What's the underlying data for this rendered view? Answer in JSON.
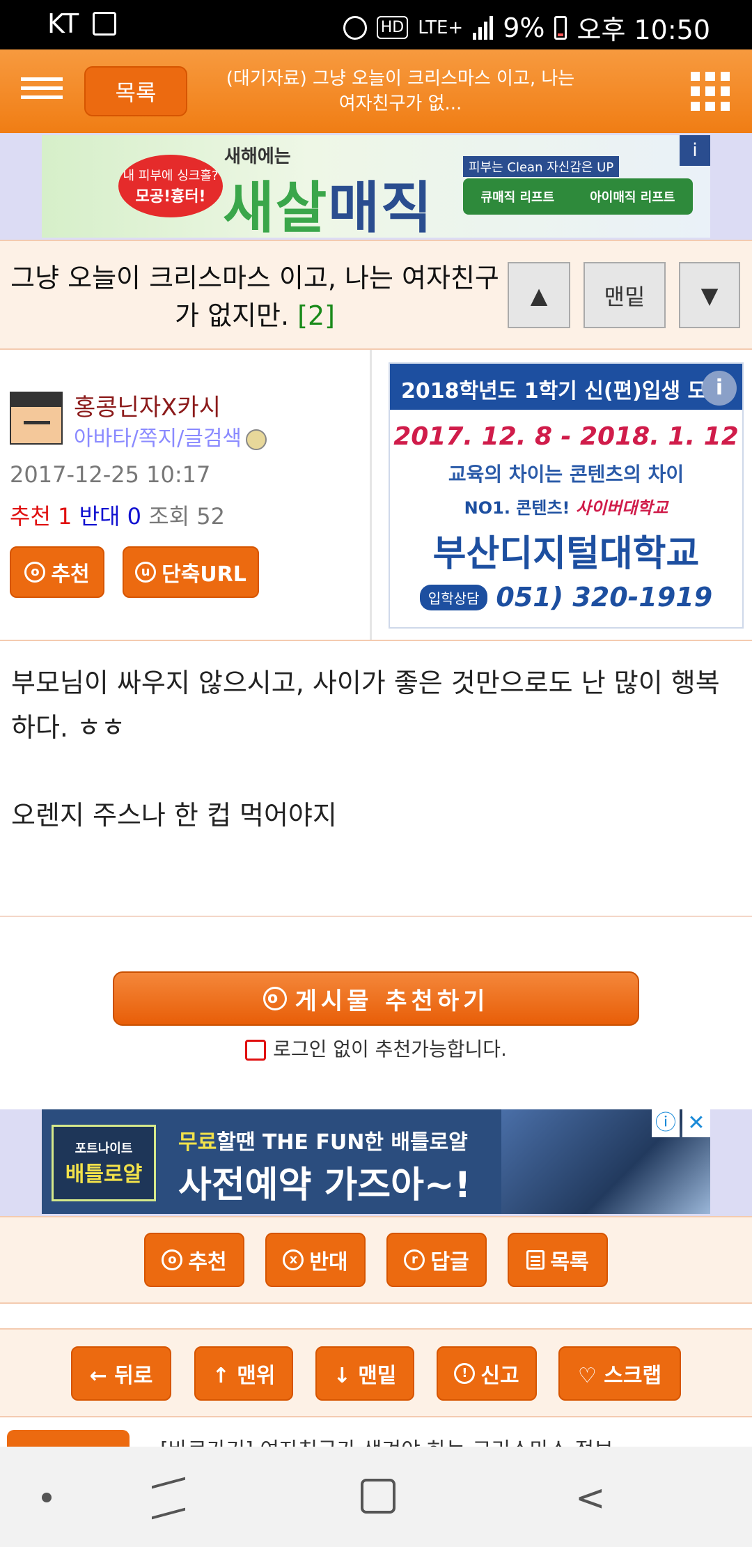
{
  "status_bar": {
    "carrier": "KT",
    "hd": "HD",
    "network": "LTE+",
    "battery": "9%",
    "time": "오후 10:50"
  },
  "header": {
    "list_label": "목록",
    "title": "(대기자료) 그냥 오늘이 크리스마스 이고, 나는 여자친구가 없..."
  },
  "top_ad": {
    "bubble_small": "내 피부에 싱크홀?",
    "bubble_big": "모공!흉터!",
    "kicker": "새해에는",
    "headline_a": "새살",
    "headline_b": "매직",
    "tag": "피부는 Clean 자신감은 UP",
    "btn1": "큐매직 리프트",
    "btn2": "아이매직 리프트",
    "corner": "i"
  },
  "post": {
    "title": "그냥 오늘이 크리스마스 이고, 나는 여자친구가 없지만.",
    "comment_count": "[2]",
    "nav_up": "▲",
    "nav_bottom": "맨밑",
    "nav_down": "▼"
  },
  "author": {
    "name": "홍콩닌자X카시",
    "links": "아바타/쪽지/글검색",
    "date": "2017-12-25 10:17",
    "rec_label": "추천 1",
    "opp_label": "반대 0",
    "views_label": "조회 52",
    "btn_recommend": "추천",
    "btn_shorturl": "단축URL",
    "icon_o": "o",
    "icon_u": "u"
  },
  "side_ad": {
    "top": "2018학년도 1학기 신(편)입생 모집",
    "i": "i",
    "date": "2017. 12. 8 - 2018. 1. 12",
    "line2": "교육의 차이는 콘텐츠의 차이",
    "line3a": "NO1. 콘텐츠!",
    "line3b": "사이버대학교",
    "uni": "부산디지털대학교",
    "pill": "입학상담",
    "phone": "051) 320-1919"
  },
  "body": {
    "p1": "부모님이 싸우지 않으시고, 사이가 좋은 것만으로도 난 많이 행복하다. ㅎㅎ",
    "p2": "오렌지 주스나 한 컵 먹어야지"
  },
  "recommend": {
    "big_label": "게시물 추천하기",
    "note": "로그인 없이 추천가능합니다.",
    "icon_o": "o"
  },
  "bottom_ad": {
    "logo_small": "포트나이트",
    "logo_big": "배틀로얄",
    "line1_a": "무료",
    "line1_b": "할땐 THE FUN한 배틀로얄",
    "line2": "사전예약 가즈아~!",
    "info": "ⓘ",
    "close": "✕"
  },
  "actions_row1": [
    {
      "label": "추천",
      "icon": "o"
    },
    {
      "label": "반대",
      "icon": "x"
    },
    {
      "label": "답글",
      "icon": "r"
    },
    {
      "label": "목록",
      "icon": ""
    }
  ],
  "actions_row2": [
    {
      "label": "← 뒤로"
    },
    {
      "label": "↑ 맨위"
    },
    {
      "label": "↓ 맨밑"
    },
    {
      "label": "신고",
      "icon": "!"
    },
    {
      "label": "♡ 스크랩"
    }
  ],
  "partial_text": "[바로가기] 여자친구가 생겨야 하는 크리스마스 정보..."
}
